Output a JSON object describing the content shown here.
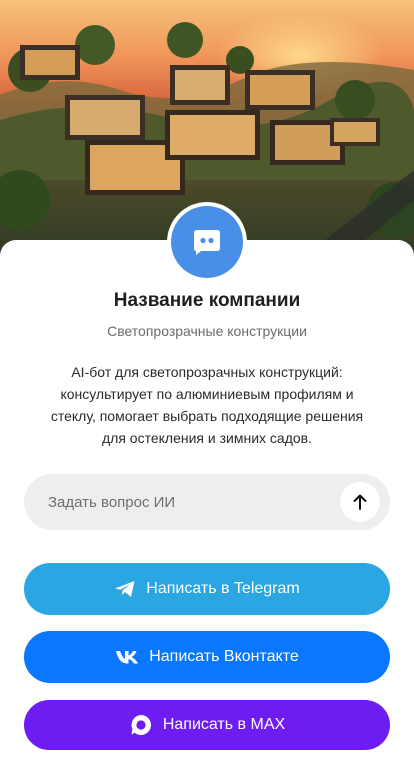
{
  "hero": {
    "image": "modern glass houses on hillside at sunset"
  },
  "profile": {
    "avatar_icon": "chat-bubble-icon",
    "company_name": "Название компании",
    "subtitle": "Светопрозрачные конструкции",
    "description": "AI-бот для светопрозрачных конструкций: консультирует по алюминиевым профилям и стеклу, помогает выбрать подходящие решения для остекления и зимних садов."
  },
  "ask": {
    "placeholder": "Задать вопрос ИИ",
    "value": "",
    "send_icon": "arrow-up-icon"
  },
  "buttons": {
    "telegram": {
      "label": "Написать в Telegram",
      "icon": "telegram-icon",
      "color": "#2aa6e2"
    },
    "vk": {
      "label": "Написать Вконтакте",
      "icon": "vk-icon",
      "color": "#0a77ff"
    },
    "max": {
      "label": "Написать в MAX",
      "icon": "max-icon",
      "color": "#6d1df2"
    }
  },
  "colors": {
    "avatar": "#4a8fe7",
    "input_bg": "#eeeeee"
  }
}
